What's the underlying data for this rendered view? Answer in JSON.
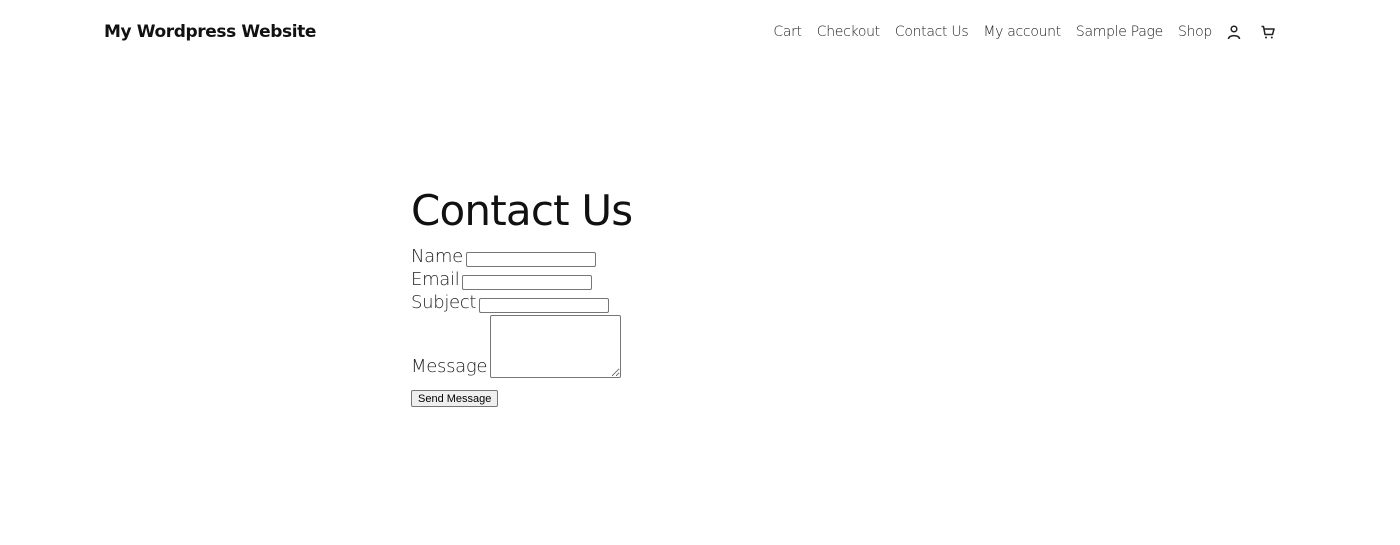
{
  "site": {
    "title": "My Wordpress Website"
  },
  "nav": {
    "items": [
      {
        "label": "Cart"
      },
      {
        "label": "Checkout"
      },
      {
        "label": "Contact Us"
      },
      {
        "label": "My account"
      },
      {
        "label": "Sample Page"
      },
      {
        "label": "Shop"
      }
    ],
    "icons": {
      "account": "user-icon",
      "cart": "cart-icon"
    }
  },
  "main": {
    "title": "Contact Us",
    "form": {
      "name_label": "Name",
      "name_value": "",
      "email_label": "Email",
      "email_value": "",
      "subject_label": "Subject",
      "subject_value": "",
      "message_label": "Message",
      "message_value": "",
      "submit_label": "Send Message"
    }
  }
}
